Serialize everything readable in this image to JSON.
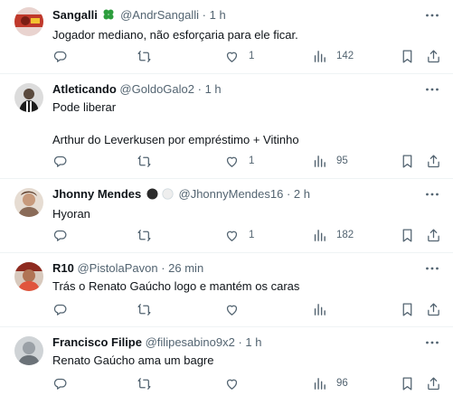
{
  "tweets": [
    {
      "name": "Sangalli",
      "badge": "clover",
      "handle": "@AndrSangalli",
      "time": "1 h",
      "text": [
        "Jogador mediano, não esforçaria para ele ficar."
      ],
      "likes": "1",
      "views": "142",
      "avatar_color": "#c0392b"
    },
    {
      "name": "Atleticando",
      "badge": "",
      "handle": "@GoldoGalo2",
      "time": "1 h",
      "text": [
        "Pode liberar",
        "Arthur do Leverkusen por empréstimo + Vitinho"
      ],
      "likes": "1",
      "views": "95",
      "avatar_color": "#444444"
    },
    {
      "name": "Jhonny Mendes",
      "badge": "black-white-circles",
      "handle": "@JhonnyMendes16",
      "time": "2 h",
      "text": [
        "Hyoran"
      ],
      "likes": "1",
      "views": "182",
      "avatar_color": "#b08a70"
    },
    {
      "name": "R10",
      "badge": "",
      "handle": "@PistolaPavon",
      "time": "26 min",
      "text": [
        "Trás o Renato Gaúcho logo e mantém os caras"
      ],
      "likes": "",
      "views": "",
      "avatar_color": "#8e2a1f"
    },
    {
      "name": "Francisco Filipe",
      "badge": "",
      "handle": "@filipesabino9x2",
      "time": "1 h",
      "text": [
        "Renato Gaúcho ama um bagre"
      ],
      "likes": "",
      "views": "96",
      "avatar_color": "#9aa0a6"
    }
  ],
  "separator": "·",
  "icons": [
    "more-icon",
    "reply-icon",
    "retweet-icon",
    "like-icon",
    "views-icon",
    "bookmark-icon",
    "share-icon"
  ],
  "colors": {
    "name": "#0f1419",
    "meta": "#536471",
    "border": "#eff3f4"
  }
}
